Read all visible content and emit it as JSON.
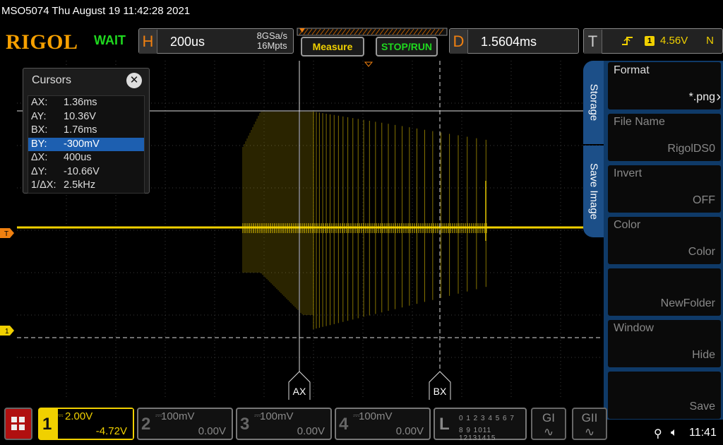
{
  "title": "MSO5074  Thu August 19 11:42:28 2021",
  "brand": "RIGOL",
  "acq_state": "WAIT",
  "horizontal": {
    "letter": "H",
    "value": "200us",
    "rate": "8GSa/s",
    "depth": "16Mpts"
  },
  "buttons": {
    "measure": "Measure",
    "stoprun": "STOP/RUN"
  },
  "delay": {
    "letter": "D",
    "value": "1.5604ms"
  },
  "trigger": {
    "letter": "T",
    "channel": "1",
    "level": "4.56V",
    "mode": "N"
  },
  "cursors": {
    "title": "Cursors",
    "rows": [
      {
        "k": "AX:",
        "v": "1.36ms"
      },
      {
        "k": "AY:",
        "v": "10.36V"
      },
      {
        "k": "BX:",
        "v": "1.76ms"
      },
      {
        "k": "BY:",
        "v": "-300mV"
      },
      {
        "k": "ΔX:",
        "v": "400us"
      },
      {
        "k": "ΔY:",
        "v": "-10.66V"
      },
      {
        "k": "1/ΔX:",
        "v": "2.5kHz"
      }
    ],
    "selected_index": 3,
    "ax_label": "AX",
    "bx_label": "BX"
  },
  "markers": {
    "trigger_level": "T",
    "channel1": "1"
  },
  "side_tabs": {
    "storage": "Storage",
    "save_image": "Save Image"
  },
  "menu": [
    {
      "title": "Format",
      "value": "*.png",
      "enabled": true
    },
    {
      "title": "File Name",
      "value": "RigolDS0",
      "enabled": false
    },
    {
      "title": "Invert",
      "value": "OFF",
      "enabled": false
    },
    {
      "title": "Color",
      "value": "Color",
      "enabled": false
    },
    {
      "title": "",
      "value": "NewFolder",
      "enabled": false
    },
    {
      "title": "Window",
      "value": "Hide",
      "enabled": false
    },
    {
      "title": "",
      "value": "Save",
      "enabled": false
    }
  ],
  "channels": [
    {
      "num": "1",
      "scale": "2.00V",
      "offset": "-4.72V",
      "active": true
    },
    {
      "num": "2",
      "scale": "100mV",
      "offset": "0.00V",
      "active": false
    },
    {
      "num": "3",
      "scale": "100mV",
      "offset": "0.00V",
      "active": false
    },
    {
      "num": "4",
      "scale": "100mV",
      "offset": "0.00V",
      "active": false
    }
  ],
  "logic": {
    "letter": "L",
    "row1": "0 1 2 3  4 5 6 7",
    "row2": "8 9 1011 12131415"
  },
  "gen1": "GI",
  "gen2": "GII",
  "clock": "11:41",
  "colors": {
    "trace": "#f0d000",
    "accent": "#f08010",
    "menu": "#0f3a68"
  }
}
